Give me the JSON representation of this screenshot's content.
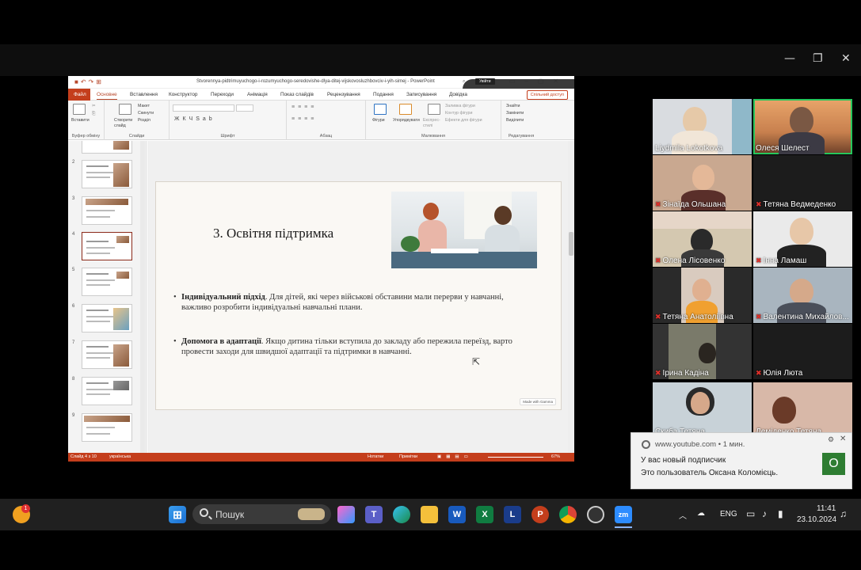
{
  "ppt": {
    "filename": "Stvorennya-pidtrimuyuchogo-i-rozumyuchogo-seredovishe-dlya-ditej-vijskovosluzhbovciv-i-yih-simej  -  PowerPoint",
    "login_button": "Увійти",
    "share_button": "Спільний доступ",
    "tabs": [
      "Файл",
      "Основне",
      "Вставлення",
      "Конструктор",
      "Переходи",
      "Анімація",
      "Показ слайдів",
      "Рецензування",
      "Подання",
      "Записування",
      "Довідка"
    ],
    "ribbon_groups": [
      "Буфер обміну",
      "Слайди",
      "Шрифт",
      "Абзац",
      "Малювання",
      "Редагування"
    ],
    "ribbon_buttons": {
      "paste": "Вставити",
      "new_slide": "Створити слайд",
      "layout": "Макет",
      "reset": "Скинути",
      "section": "Розділ",
      "shapes": "Фігури",
      "arrange": "Упорядкувати",
      "quick_styles": "Експрес-стилі",
      "shape_fill": "Заливка фігури",
      "shape_outline": "Контур фігури",
      "shape_effects": "Ефекти для фігури",
      "find": "Знайти",
      "replace": "Замінити",
      "select": "Виділити"
    },
    "thumb_numbers": [
      "2",
      "3",
      "4",
      "5",
      "6",
      "7",
      "8",
      "9"
    ],
    "slide": {
      "title": "3. Освітня підтримка",
      "bullets": [
        {
          "bold": "Індивідуальний підхід",
          "text": ". Для дітей, які через військові обставини мали перерви у навчанні, важливо розробити індивідуальні навчальні плани."
        },
        {
          "bold": "Допомога в адаптації",
          "text": ". Якщо дитина тільки вступила до закладу або пережила переїзд, варто провести заходи для швидшої адаптації та підтримки в навчанні."
        }
      ],
      "badge": "Made with Gamma"
    },
    "status": {
      "slide_info": "Слайд 4 з 10",
      "language": "українська",
      "notes": "Нотатки",
      "comments": "Примітки",
      "zoom": "67%"
    }
  },
  "participants": [
    {
      "name": "Liydmila Lokotkova",
      "muted": false
    },
    {
      "name": "Олеся Шелест",
      "muted": false,
      "active": true
    },
    {
      "name": "Зінаїда Ольшана",
      "muted": true
    },
    {
      "name": "Тетяна Ведмеденко",
      "muted": true
    },
    {
      "name": "Олена Лісовенко",
      "muted": true
    },
    {
      "name": "Інна Ламаш",
      "muted": true
    },
    {
      "name": "Тетяна Анатоліївна",
      "muted": true
    },
    {
      "name": "Валентина Михайлов...",
      "muted": true
    },
    {
      "name": "Ірина Кадіна",
      "muted": true
    },
    {
      "name": "Юлія Люта",
      "muted": true
    },
    {
      "name": "Скиба Тетяна",
      "muted": false
    },
    {
      "name": "Деміденко Тетяна",
      "muted": false
    }
  ],
  "notification": {
    "source": "www.youtube.com",
    "time": "1 мин.",
    "line1": "У вас новый подписчик",
    "line2": "Это пользователь Оксана Коломієць.",
    "avatar_letter": "О"
  },
  "taskbar": {
    "search_label": "Пошук",
    "badge_count": "1",
    "lang": "ENG",
    "time": "11:41",
    "date": "23.10.2024"
  }
}
